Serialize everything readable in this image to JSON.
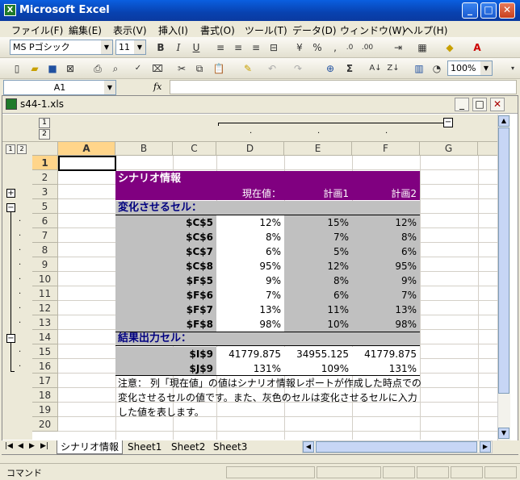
{
  "app": {
    "title": "Microsoft Excel"
  },
  "menu": [
    "ファイル(F)",
    "編集(E)",
    "表示(V)",
    "挿入(I)",
    "書式(O)",
    "ツール(T)",
    "データ(D)",
    "ウィンドウ(W)",
    "ヘルプ(H)"
  ],
  "format_toolbar": {
    "font": "MS Pゴシック",
    "size": "11"
  },
  "standard_toolbar": {
    "zoom": "100%"
  },
  "formula": {
    "name_box": "A1",
    "fx": "fx",
    "content": ""
  },
  "workbook": {
    "title": "s44-1.xls"
  },
  "outline": {
    "level1": "1",
    "level2": "2"
  },
  "columns": [
    "A",
    "B",
    "C",
    "D",
    "E",
    "F",
    "G"
  ],
  "rows": [
    "1",
    "2",
    "3",
    "5",
    "6",
    "7",
    "8",
    "9",
    "10",
    "11",
    "12",
    "13",
    "14",
    "15",
    "16",
    "17",
    "18",
    "19",
    "20"
  ],
  "scenario": {
    "title": "シナリオ情報",
    "h_current": "現在値：",
    "h_plan1": "計画1",
    "h_plan2": "計画2",
    "change_label": "変化させるセル：",
    "changes": [
      {
        "cell": "$C$5",
        "cur": "12%",
        "p1": "15%",
        "p2": "12%"
      },
      {
        "cell": "$C$6",
        "cur": "8%",
        "p1": "7%",
        "p2": "8%"
      },
      {
        "cell": "$C$7",
        "cur": "6%",
        "p1": "5%",
        "p2": "6%"
      },
      {
        "cell": "$C$8",
        "cur": "95%",
        "p1": "12%",
        "p2": "95%"
      },
      {
        "cell": "$F$5",
        "cur": "9%",
        "p1": "8%",
        "p2": "9%"
      },
      {
        "cell": "$F$6",
        "cur": "7%",
        "p1": "6%",
        "p2": "7%"
      },
      {
        "cell": "$F$7",
        "cur": "13%",
        "p1": "11%",
        "p2": "13%"
      },
      {
        "cell": "$F$8",
        "cur": "98%",
        "p1": "10%",
        "p2": "98%"
      }
    ],
    "result_label": "結果出力セル：",
    "results": [
      {
        "cell": "$I$9",
        "cur": "41779.875",
        "p1": "34955.125",
        "p2": "41779.875"
      },
      {
        "cell": "$J$9",
        "cur": "131%",
        "p1": "109%",
        "p2": "131%"
      }
    ],
    "note": [
      "注意： 列「現在値」の値はシナリオ情報レポートが作成した時点での",
      "変化させるセルの値です。また、灰色のセルは変化させるセルに入力",
      "した値を表します。"
    ]
  },
  "sheets": [
    "シナリオ情報",
    "Sheet1",
    "Sheet2",
    "Sheet3"
  ],
  "status": {
    "text": "コマンド"
  },
  "colors": {
    "header_purple": "#800080",
    "gray_cell": "#c0c0c0",
    "label_blue": "#000080"
  }
}
